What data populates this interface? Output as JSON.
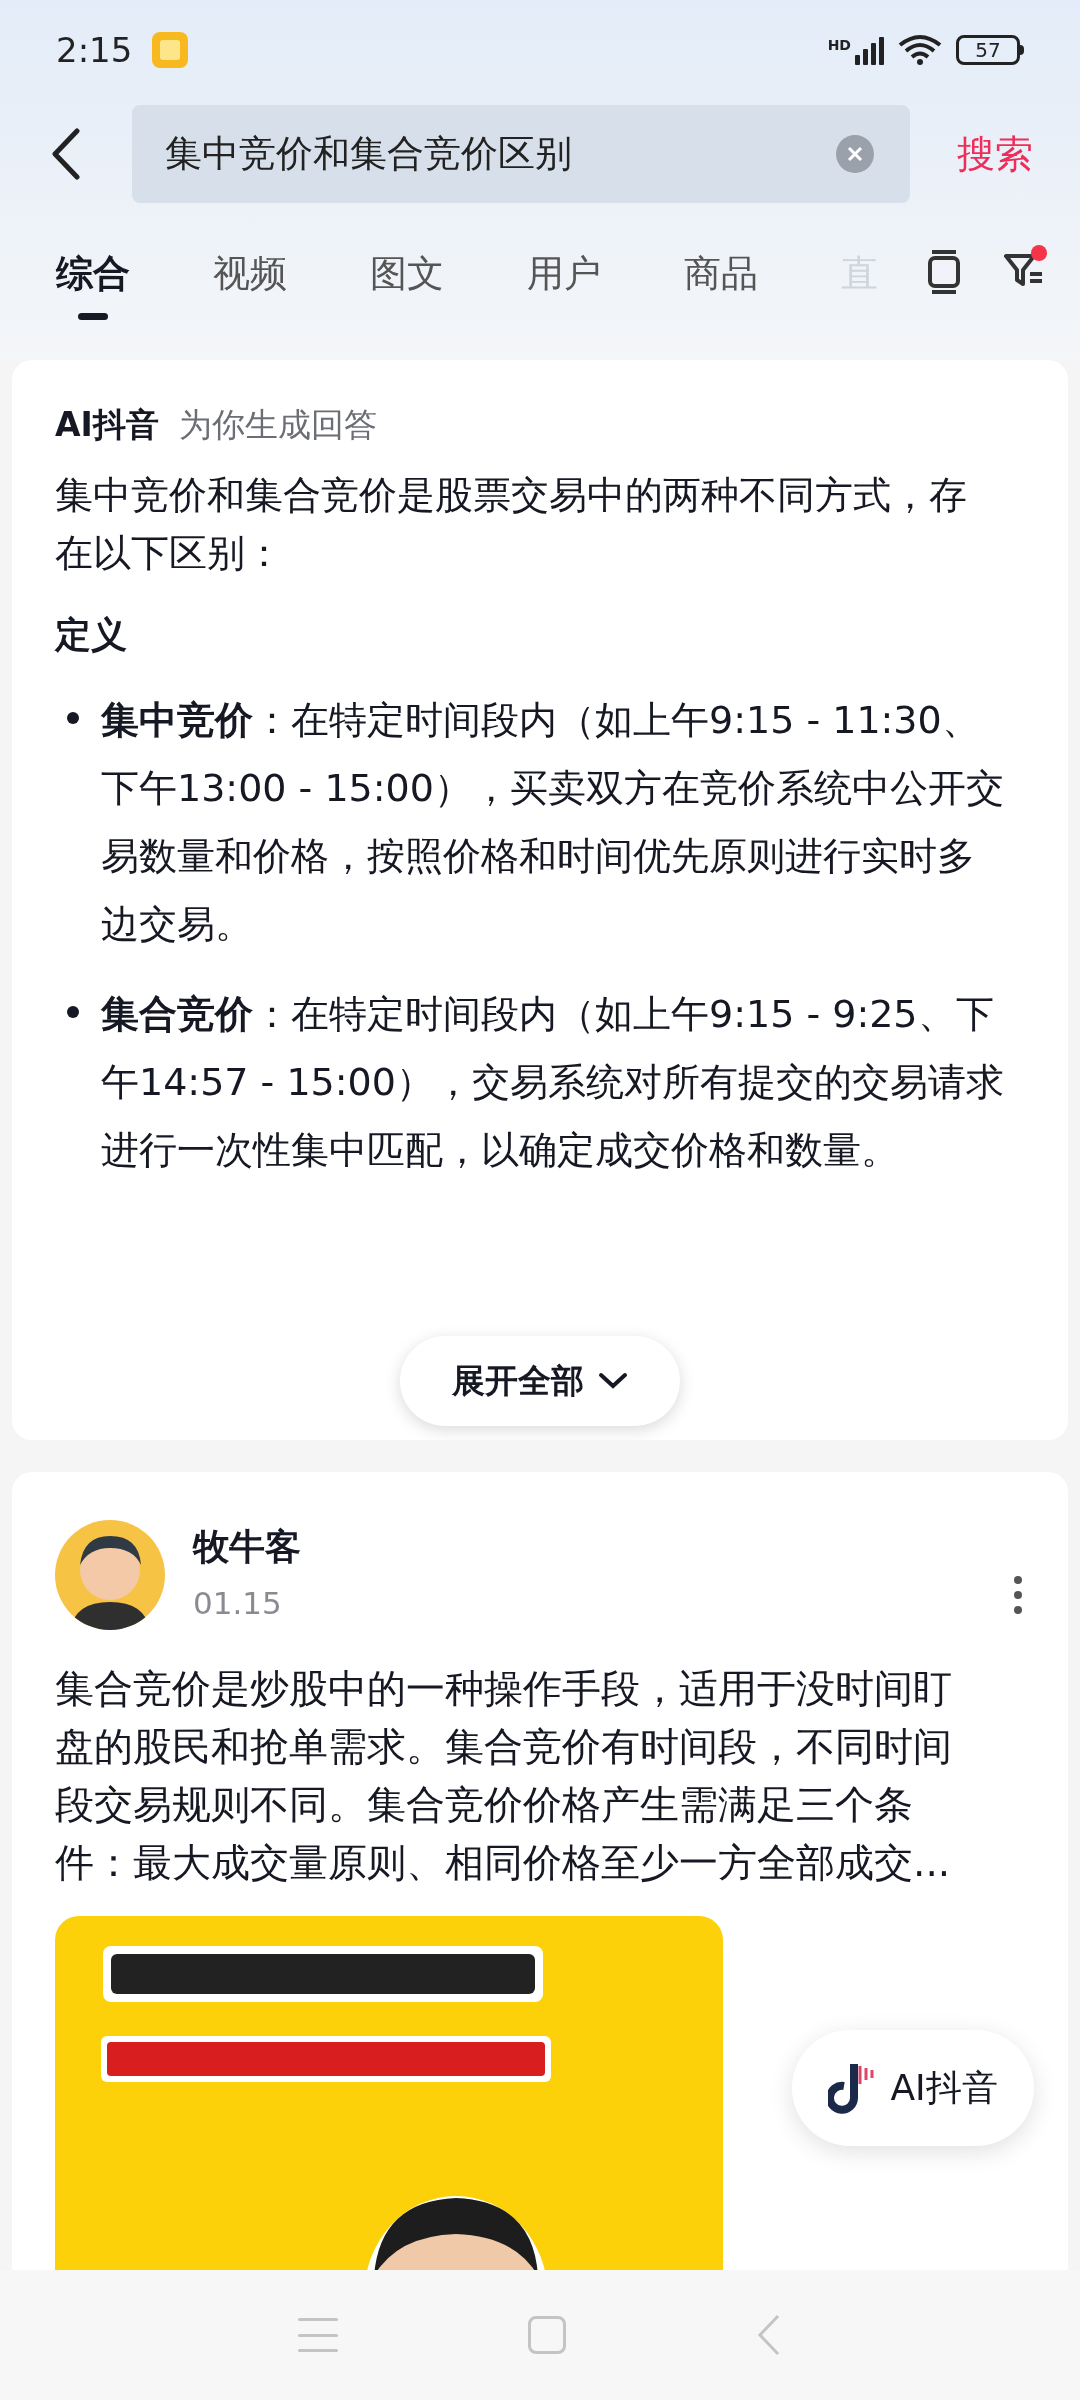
{
  "status_bar": {
    "time": "2:15",
    "network": "HD",
    "battery": "57"
  },
  "search": {
    "value": "集中竞价和集合竞价区别",
    "action": "搜索"
  },
  "tabs": [
    {
      "label": "综合",
      "selected": true
    },
    {
      "label": "视频",
      "selected": false
    },
    {
      "label": "图文",
      "selected": false
    },
    {
      "label": "用户",
      "selected": false
    },
    {
      "label": "商品",
      "selected": false
    },
    {
      "label": "直",
      "selected": false
    }
  ],
  "ai_answer": {
    "brand": "AI抖音",
    "subtitle": "为你生成回答",
    "intro": "集中竞价和集合竞价是股票交易中的两种不同方式，存在以下区别：",
    "heading": "定义",
    "bullets": [
      "**集中竞价**：在特定时间段内（如上午9:15 - 11:30、下午13:00 - 15:00），买卖双方在竞价系统中公开交易数量和价格，按照价格和时间优先原则进行实时多边交易。",
      "**集合竞价**：在特定时间段内（如上午9:15 - 9:25、下午14:57 - 15:00），交易系统对所有提交的交易请求进行一次性集中匹配，以确定成交价格和数量。"
    ],
    "expand_button": "展开全部"
  },
  "post": {
    "author": "牧牛客",
    "date": "01.15",
    "text": "集合竞价是炒股中的一种操作手段，适用于没时间盯盘的股民和抢单需求。集合竞价有时间段，不同时间段交易规则不同。集合竞价价格产生需满足三个条件：最大成交量原则、相同价格至少一方全部成交..."
  },
  "floating_button": "AI抖音"
}
